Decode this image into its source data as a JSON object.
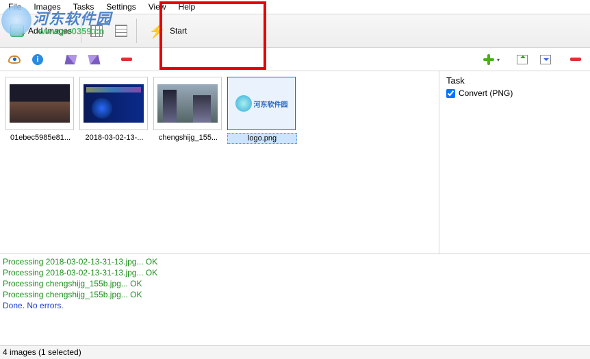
{
  "menu": {
    "file": "File",
    "images": "Images",
    "tasks": "Tasks",
    "settings": "Settings",
    "view": "View",
    "help": "Help"
  },
  "toolbar": {
    "add_images": "Add Images",
    "start": "Start"
  },
  "thumbs": [
    {
      "label": "01ebec5985e81...",
      "sel": false,
      "kind": "img1"
    },
    {
      "label": "2018-03-02-13-...",
      "sel": false,
      "kind": "img2"
    },
    {
      "label": "chengshijg_155...",
      "sel": false,
      "kind": "img3"
    },
    {
      "label": "logo.png",
      "sel": true,
      "kind": "logo"
    }
  ],
  "task": {
    "header": "Task",
    "item": "Convert (PNG)",
    "checked": true
  },
  "log": [
    {
      "cls": "ok",
      "text": "Processing 2018-03-02-13-31-13.jpg... OK"
    },
    {
      "cls": "ok",
      "text": "Processing 2018-03-02-13-31-13.jpg... OK"
    },
    {
      "cls": "ok",
      "text": "Processing chengshijg_155b.jpg... OK"
    },
    {
      "cls": "ok",
      "text": "Processing chengshijg_155b.jpg... OK"
    },
    {
      "cls": "done",
      "text": "Done. No errors."
    }
  ],
  "status": "4 images (1 selected)",
  "watermark": {
    "title": "河东软件园",
    "url": "www.pc0359.cn"
  },
  "logo_text": "河东软件园"
}
